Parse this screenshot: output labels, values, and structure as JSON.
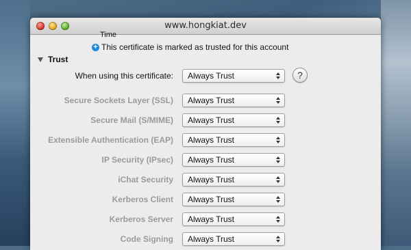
{
  "window": {
    "title": "www.hongkiat.dev"
  },
  "cut_off_label": "Time",
  "trust_message": "This certificate is marked as trusted for this account",
  "trust_section": {
    "heading": "Trust",
    "main_setting": {
      "label": "When using this certificate:",
      "value": "Always Trust",
      "help": "?"
    },
    "settings": [
      {
        "label": "Secure Sockets Layer (SSL)",
        "value": "Always Trust"
      },
      {
        "label": "Secure Mail (S/MIME)",
        "value": "Always Trust"
      },
      {
        "label": "Extensible Authentication (EAP)",
        "value": "Always Trust"
      },
      {
        "label": "IP Security (IPsec)",
        "value": "Always Trust"
      },
      {
        "label": "iChat Security",
        "value": "Always Trust"
      },
      {
        "label": "Kerberos Client",
        "value": "Always Trust"
      },
      {
        "label": "Kerberos Server",
        "value": "Always Trust"
      },
      {
        "label": "Code Signing",
        "value": "Always Trust"
      }
    ]
  },
  "icons": {
    "close": "close-button-icon",
    "minimize": "minimize-button-icon",
    "zoom": "zoom-button-icon",
    "info": "plus-circle-icon",
    "disclosure": "disclosure-triangle-icon",
    "popup": "up-down-arrows-icon"
  },
  "colors": {
    "info_blue": "#1d87d8",
    "disabled_label": "#9a9a9a"
  }
}
